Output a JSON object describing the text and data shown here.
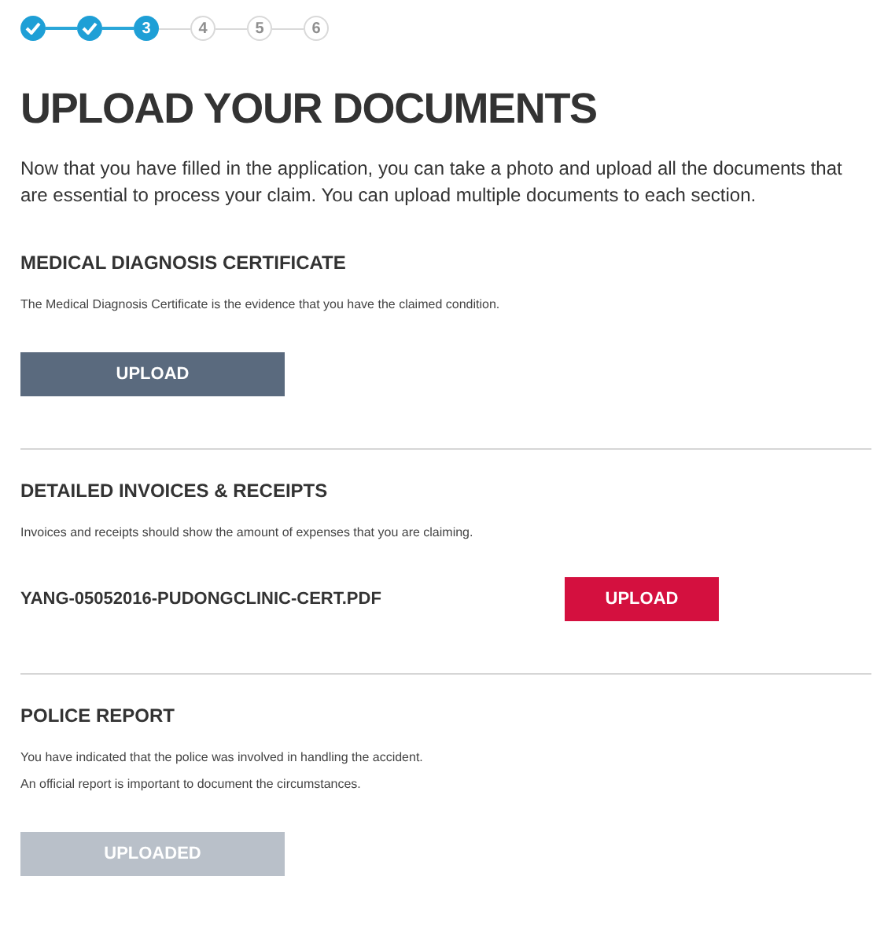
{
  "steps": [
    {
      "completed": true
    },
    {
      "completed": true
    },
    {
      "label": "3",
      "completed": false,
      "selected": true
    },
    {
      "label": "4",
      "completed": false,
      "selected": false
    },
    {
      "label": "5",
      "completed": false,
      "selected": false
    },
    {
      "label": "6",
      "completed": false,
      "selected": false
    }
  ],
  "title": "UPLOAD YOUR DOCUMENTS",
  "intro": "Now that you have filled in the application, you can take a photo and upload all the documents that are essential to process your claim. You can upload multiple documents to each section.",
  "sections": [
    {
      "heading": "MEDICAL DIAGNOSIS CERTIFICATE",
      "description": [
        "The Medical Diagnosis Certificate is the evidence that you have the claimed condition."
      ],
      "button": {
        "label": "UPLOAD",
        "kind": "primary"
      }
    },
    {
      "heading": "DETAILED INVOICES & RECEIPTS",
      "description": [
        "Invoices and receipts should show the amount of expenses that you are claiming."
      ],
      "file": "YANG-05052016-PUDONGCLINIC-CERT.PDF",
      "button": {
        "label": "UPLOAD",
        "kind": "accent"
      }
    },
    {
      "heading": "POLICE REPORT",
      "description": [
        "You have indicated that the police was involved in handling the accident.",
        "An official report is important to document the circumstances."
      ],
      "button": {
        "label": "UPLOADED",
        "kind": "disabled"
      }
    }
  ]
}
